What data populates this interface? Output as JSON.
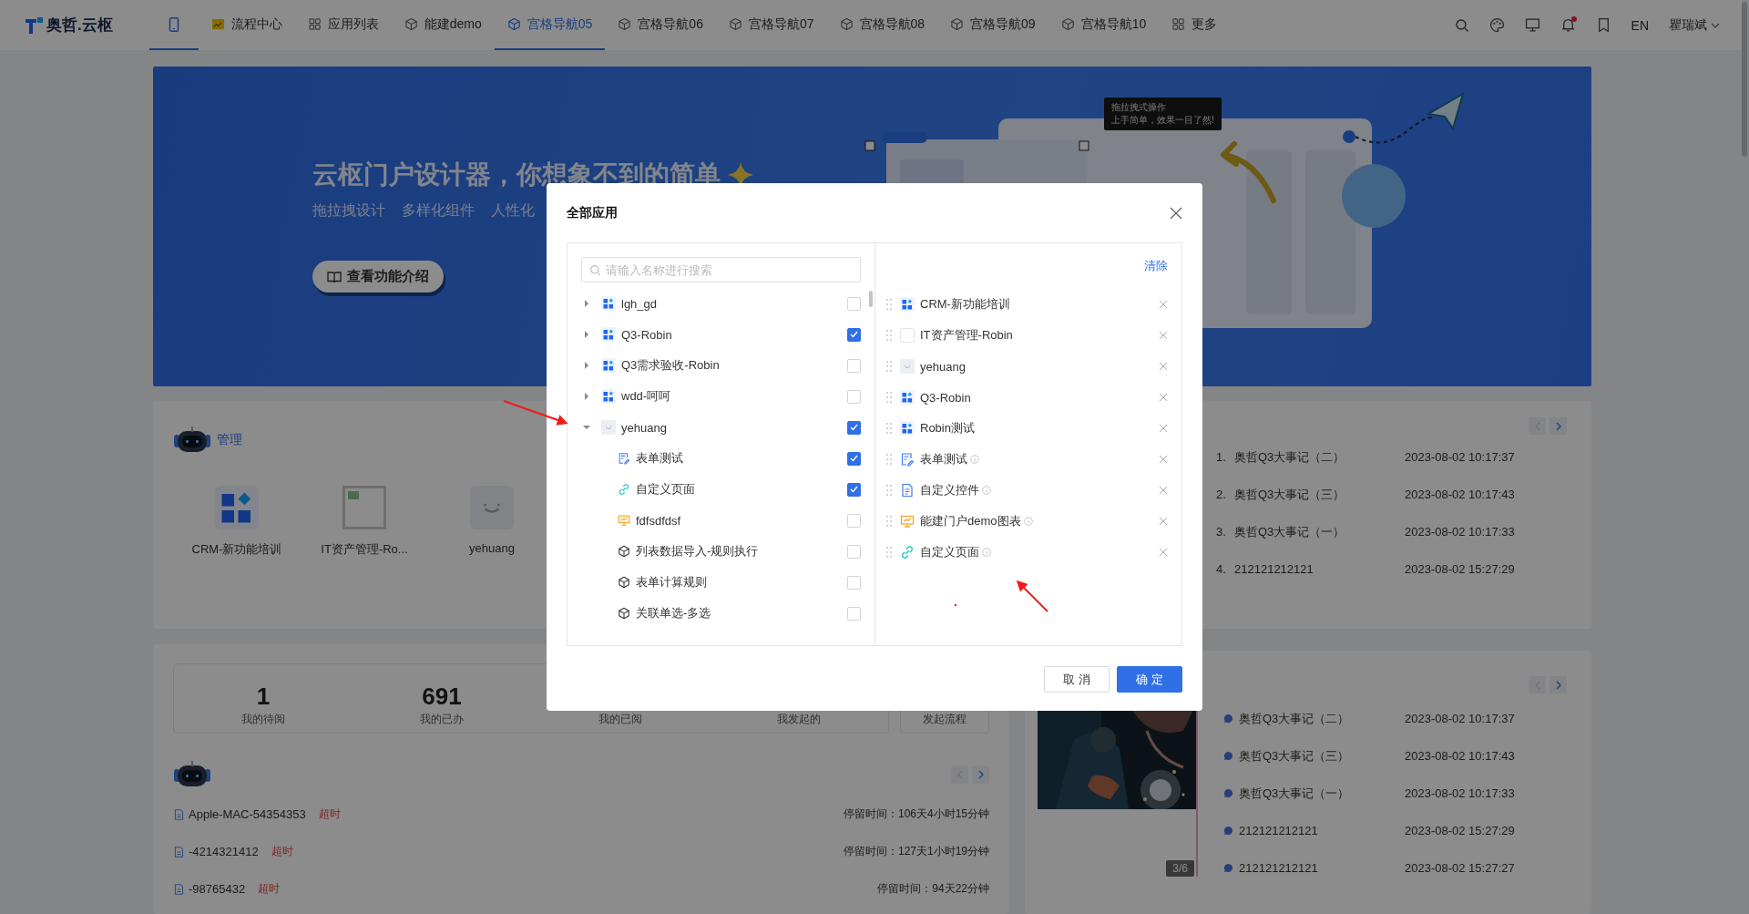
{
  "nav": {
    "logo": "奥哲.云枢",
    "tabs": [
      {
        "kind": "phone",
        "selected": true
      },
      {
        "kind": "flow",
        "label": "流程中心",
        "selected": false
      },
      {
        "kind": "apps",
        "label": "应用列表",
        "selected": false
      },
      {
        "kind": "cube",
        "label": "能建demo",
        "selected": false
      },
      {
        "kind": "cube",
        "label": "宫格导航05",
        "selected": true
      },
      {
        "kind": "cube",
        "label": "宫格导航06",
        "selected": false
      },
      {
        "kind": "cube",
        "label": "宫格导航07",
        "selected": false
      },
      {
        "kind": "cube",
        "label": "宫格导航08",
        "selected": false
      },
      {
        "kind": "cube",
        "label": "宫格导航09",
        "selected": false
      },
      {
        "kind": "cube",
        "label": "宫格导航10",
        "selected": false
      },
      {
        "kind": "apps",
        "label": "更多",
        "selected": false
      }
    ],
    "bell_badge": true,
    "language": "EN",
    "user": "瞿瑞斌"
  },
  "banner": {
    "title": "云枢门户设计器，你想象不到的简单",
    "features": [
      "拖拉拽设计",
      "多样化组件",
      "人性化"
    ],
    "button": "查看功能介绍",
    "tooltip": [
      "拖拉拽式操作",
      "上手简单，效果一目了然!"
    ]
  },
  "manage_card": {
    "title": "管理",
    "apps": [
      {
        "label": "CRM-新功能培训",
        "kind": "grid"
      },
      {
        "label": "IT资产管理-Ro...",
        "kind": "broken"
      },
      {
        "label": "yehuang",
        "kind": "smiley"
      }
    ]
  },
  "flow_card": {
    "stats": [
      {
        "value": "1",
        "label": "我的待阅"
      },
      {
        "value": "691",
        "label": "我的已办"
      },
      {
        "label": "我的已阅"
      },
      {
        "label": "我发起的"
      }
    ],
    "start_button": "发起流程",
    "pager": {
      "prev_disabled": true,
      "next_disabled": false
    },
    "items": [
      {
        "title": "Apple-MAC-54354353",
        "tag": "超时",
        "stay": "停留时间：106天4小时15分钟"
      },
      {
        "title": "-4214321412",
        "tag": "超时",
        "stay": "停留时间：127天1小时19分钟"
      },
      {
        "title": "-98765432",
        "tag": "超时",
        "stay": "停留时间：94天22分钟"
      }
    ]
  },
  "news_card": {
    "pager": {
      "prev_disabled": true,
      "next_disabled": false
    },
    "items": [
      {
        "index": "1.",
        "title": "奥哲Q3大事记（二）",
        "date": "2023-08-02 10:17:37"
      },
      {
        "index": "2.",
        "title": "奥哲Q3大事记（三）",
        "date": "2023-08-02 10:17:43"
      },
      {
        "index": "3.",
        "title": "奥哲Q3大事记（一）",
        "date": "2023-08-02 10:17:33"
      },
      {
        "index": "4.",
        "title": "212121212121",
        "date": "2023-08-02 15:27:29"
      }
    ]
  },
  "gallery_card": {
    "pager": {
      "prev_disabled": true,
      "next_disabled": false
    },
    "counter": "3/6",
    "items": [
      {
        "title": "奥哲Q3大事记（二）",
        "date": "2023-08-02 10:17:37"
      },
      {
        "title": "奥哲Q3大事记（三）",
        "date": "2023-08-02 10:17:43"
      },
      {
        "title": "奥哲Q3大事记（一）",
        "date": "2023-08-02 10:17:33"
      },
      {
        "title": "212121212121",
        "date": "2023-08-02 15:27:29"
      },
      {
        "title": "212121212121",
        "date": "2023-08-02 15:27:27"
      }
    ]
  },
  "dialog": {
    "title": "全部应用",
    "search": {
      "placeholder": "请输入名称进行搜索"
    },
    "tree": [
      {
        "label": "lgh_gd",
        "kind": "grid",
        "expanded": false,
        "checked": false
      },
      {
        "label": "Q3-Robin",
        "kind": "grid",
        "expanded": false,
        "checked": true
      },
      {
        "label": "Q3需求验收-Robin",
        "kind": "grid",
        "expanded": false,
        "checked": false
      },
      {
        "label": "wdd-呵呵",
        "kind": "grid",
        "expanded": false,
        "checked": false
      },
      {
        "label": "yehuang",
        "kind": "smiley",
        "expanded": true,
        "checked": true,
        "children": [
          {
            "label": "表单测试",
            "kind": "form",
            "checked": true
          },
          {
            "label": "自定义页面",
            "kind": "link",
            "checked": true
          },
          {
            "label": "fdfsdfdsf",
            "kind": "chart",
            "checked": false
          },
          {
            "label": "列表数据导入-规则执行",
            "kind": "cube",
            "checked": false
          },
          {
            "label": "表单计算规则",
            "kind": "cube",
            "checked": false
          },
          {
            "label": "关联单选-多选",
            "kind": "cube",
            "checked": false
          }
        ]
      }
    ],
    "clear": "清除",
    "selected": [
      {
        "label": "CRM-新功能培训",
        "kind": "grid",
        "info": false
      },
      {
        "label": "IT资产管理-Robin",
        "kind": "blank",
        "info": false
      },
      {
        "label": "yehuang",
        "kind": "smiley",
        "info": false
      },
      {
        "label": "Q3-Robin",
        "kind": "grid",
        "info": false
      },
      {
        "label": "Robin测试",
        "kind": "grid",
        "info": false
      },
      {
        "label": "表单测试",
        "kind": "form",
        "info": true
      },
      {
        "label": "自定义控件",
        "kind": "doc",
        "info": true
      },
      {
        "label": "能建门户demo图表",
        "kind": "chart",
        "info": true
      },
      {
        "label": "自定义页面",
        "kind": "link",
        "info": true
      }
    ],
    "cancel": "取 消",
    "ok": "确 定"
  }
}
